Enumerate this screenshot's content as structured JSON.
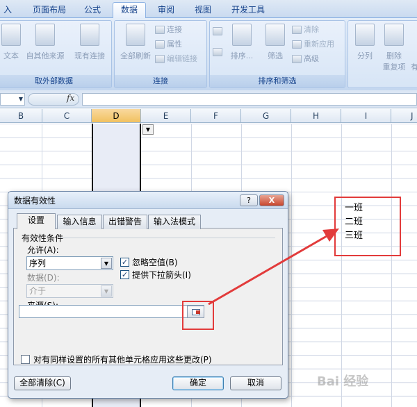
{
  "ribbon": {
    "tabs": [
      "入",
      "页面布局",
      "公式",
      "数据",
      "审阅",
      "视图",
      "开发工具"
    ],
    "active_tab": "数据",
    "groups": {
      "external": {
        "label": "取外部数据",
        "from_text": "文本",
        "from_other": "自其他来源",
        "existing": "现有连接"
      },
      "connections": {
        "label": "连接",
        "refresh_all": "全部刷新",
        "connections": "连接",
        "properties": "属性",
        "edit_links": "编辑链接"
      },
      "sort_filter": {
        "label": "排序和筛选",
        "sort": "排序...",
        "filter": "筛选",
        "clear": "清除",
        "reapply": "重新应用",
        "advanced": "高级"
      },
      "data_tools": {
        "split": "分列",
        "remove_dup_1": "删除",
        "remove_dup_2": "重复项",
        "truncated": "有"
      }
    }
  },
  "formula_bar": {
    "fx": "fx"
  },
  "columns": [
    "B",
    "C",
    "D",
    "E",
    "F",
    "G",
    "H",
    "I",
    "J"
  ],
  "selected_column": "D",
  "annotation": {
    "items": [
      "一班",
      "二班",
      "三班"
    ]
  },
  "dialog": {
    "title": "数据有效性",
    "help": "?",
    "close": "X",
    "tabs": [
      "设置",
      "输入信息",
      "出错警告",
      "输入法模式"
    ],
    "active_tab": "设置",
    "criteria_title": "有效性条件",
    "allow_label": "允许(A):",
    "allow_value": "序列",
    "data_label": "数据(D):",
    "data_value": "介于",
    "ignore_blank": "忽略空值(B)",
    "in_cell_dropdown": "提供下拉箭头(I)",
    "source_label": "来源(S):",
    "source_value": "",
    "apply_all": "对有同样设置的所有其他单元格应用这些更改(P)",
    "clear_all": "全部清除(C)",
    "ok": "确定",
    "cancel": "取消"
  },
  "watermark": "Bai 经验",
  "colors": {
    "annotation": "#e23b3b",
    "ribbon": "#d1e0f3",
    "selected_header": "#f1c15f"
  }
}
